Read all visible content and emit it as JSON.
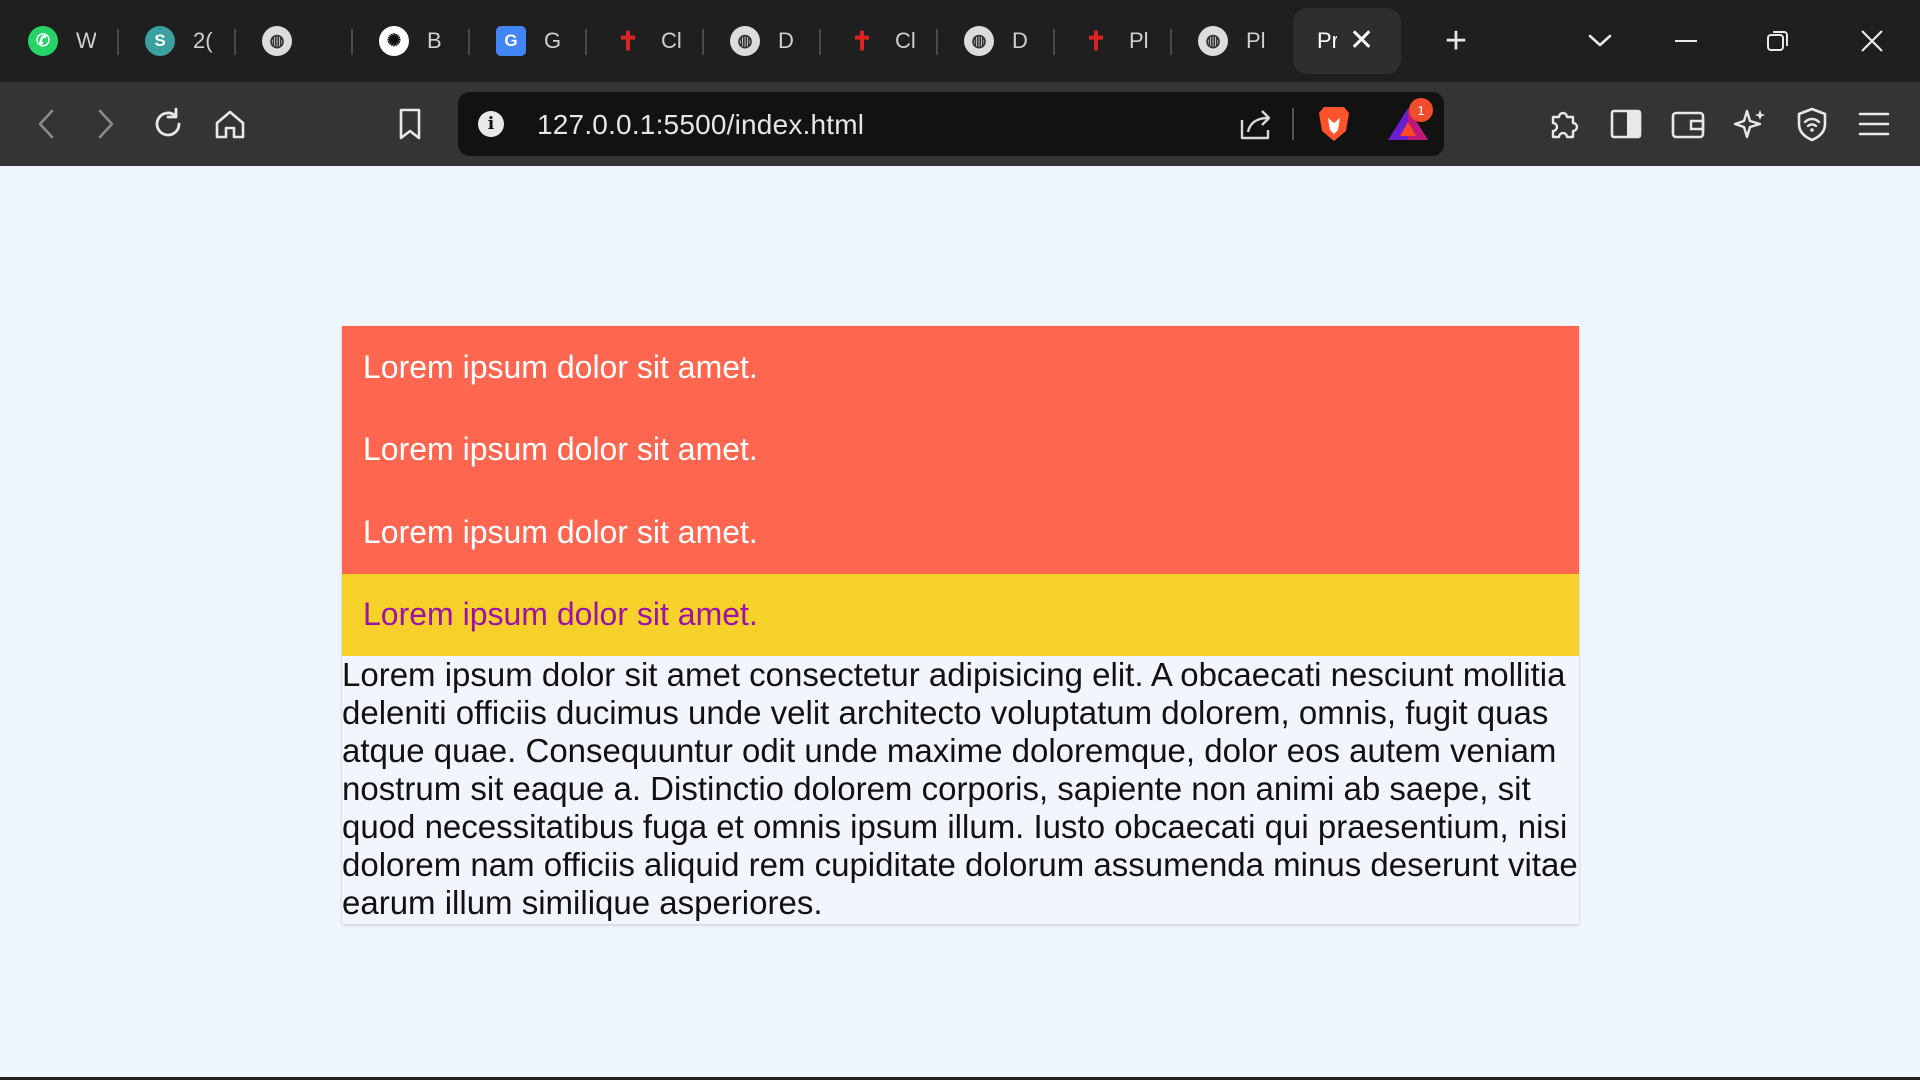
{
  "tabs": [
    {
      "title": "W",
      "icon": "whatsapp-icon",
      "glyph": "✆",
      "cls": "fav-wa"
    },
    {
      "title": "2(",
      "icon": "s-logo-icon",
      "glyph": "S",
      "cls": "fav-s"
    },
    {
      "title": "",
      "icon": "globe-icon",
      "glyph": "◍",
      "cls": "fav-globe"
    },
    {
      "title": "B",
      "icon": "chatgpt-icon",
      "glyph": "✺",
      "cls": "fav-gpt"
    },
    {
      "title": "G",
      "icon": "google-translate-icon",
      "glyph": "G",
      "cls": "fav-gt"
    },
    {
      "title": "Cl",
      "icon": "figure-icon",
      "glyph": "✝",
      "cls": "fav-fig"
    },
    {
      "title": "D",
      "icon": "globe-icon",
      "glyph": "◍",
      "cls": "fav-globe"
    },
    {
      "title": "Cl",
      "icon": "figure-icon",
      "glyph": "✝",
      "cls": "fav-fig"
    },
    {
      "title": "D",
      "icon": "globe-icon",
      "glyph": "◍",
      "cls": "fav-globe"
    },
    {
      "title": "Pl",
      "icon": "figure-icon",
      "glyph": "✝",
      "cls": "fav-fig"
    },
    {
      "title": "Pl",
      "icon": "globe-icon",
      "glyph": "◍",
      "cls": "fav-globe"
    }
  ],
  "active_tab": {
    "title": "Pr",
    "close": "✕"
  },
  "new_tab": "+",
  "address_bar": {
    "url": "127.0.0.1:5500/index.html",
    "info": "i"
  },
  "rewards_badge": "1",
  "content": {
    "items": [
      "Lorem ipsum dolor sit amet.",
      "Lorem ipsum dolor sit amet.",
      "Lorem ipsum dolor sit amet.",
      "Lorem ipsum dolor sit amet."
    ],
    "paragraph": "Lorem ipsum dolor sit amet consectetur adipisicing elit. A obcaecati nesciunt mollitia deleniti officiis ducimus unde velit architecto voluptatum dolorem, omnis, fugit quas atque quae. Consequuntur odit unde maxime doloremque, dolor eos autem veniam nostrum sit eaque a. Distinctio dolorem corporis, sapiente non animi ab saepe, sit quod necessitatibus fuga et omnis ipsum illum. Iusto obcaecati qui praesentium, nisi dolorem nam officiis aliquid rem cupiditate dolorum assumenda minus deserunt vitae earum illum similique asperiores."
  },
  "colors": {
    "item_bg": "#ff6650",
    "highlight_bg": "#f5d12a",
    "highlight_text": "#9c14a6",
    "page_bg": "#eff6ff"
  }
}
